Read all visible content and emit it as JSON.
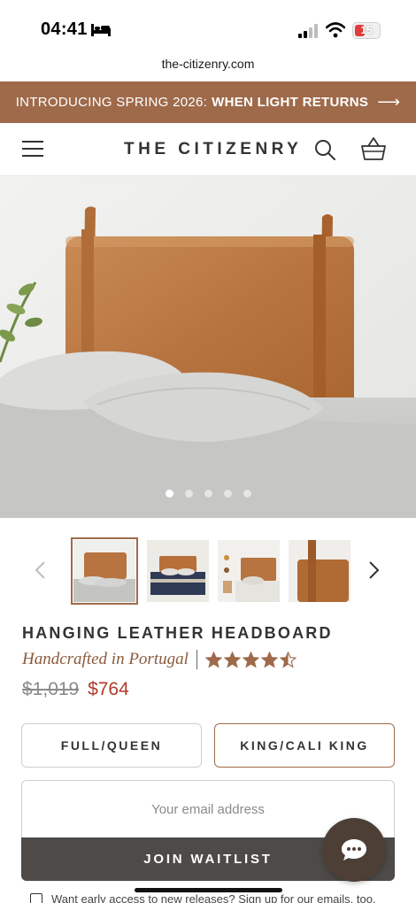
{
  "status_bar": {
    "time": "04:41",
    "battery": "15"
  },
  "browser": {
    "url": "the-citizenry.com"
  },
  "promo": {
    "text": "INTRODUCING SPRING 2026:",
    "highlight": "WHEN LIGHT RETURNS",
    "arrow": "⟶"
  },
  "header": {
    "logo": "THE CITIZENRY",
    "icons": [
      "menu-icon",
      "search-icon",
      "cart-icon"
    ]
  },
  "gallery": {
    "slide_count": 5,
    "active_slide": 1,
    "thumbnail_count": 4,
    "selected_thumbnail": 1
  },
  "product": {
    "title": "HANGING LEATHER HEADBOARD",
    "origin": "Handcrafted in Portugal",
    "rating": 4.5,
    "rating_max": 5,
    "old_price": "$1,019",
    "price": "$764"
  },
  "sizes": {
    "options": [
      "FULL/QUEEN",
      "KING/CALI KING"
    ],
    "selected": "KING/CALI KING"
  },
  "waitlist": {
    "email_placeholder": "Your email address",
    "email_value": "",
    "button_label": "JOIN WAITLIST",
    "consent_text": "Want early access to new releases? Sign up for our emails, too."
  },
  "colors": {
    "brand_brown": "#9e6a4a",
    "sale_red": "#b23a2a",
    "button_dark": "#4d4a48",
    "chat_button": "#4d3f36"
  }
}
